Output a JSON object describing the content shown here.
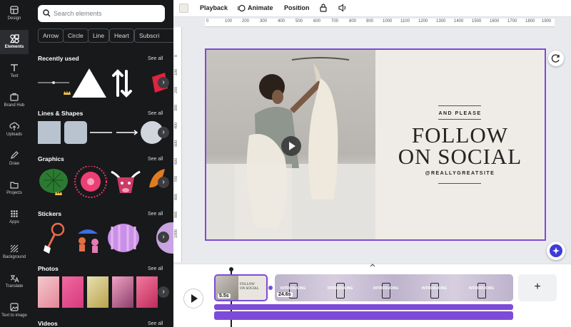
{
  "rail": {
    "items": [
      {
        "label": "Design",
        "icon": "design-icon"
      },
      {
        "label": "Elements",
        "icon": "elements-icon"
      },
      {
        "label": "Text",
        "icon": "text-icon"
      },
      {
        "label": "Brand Hub",
        "icon": "brand-hub-icon"
      },
      {
        "label": "Uploads",
        "icon": "uploads-icon"
      },
      {
        "label": "Draw",
        "icon": "draw-icon"
      },
      {
        "label": "Projects",
        "icon": "projects-icon"
      },
      {
        "label": "Apps",
        "icon": "apps-icon"
      },
      {
        "label": "Background",
        "icon": "background-icon"
      },
      {
        "label": "Translate",
        "icon": "translate-icon"
      },
      {
        "label": "Text to image",
        "icon": "text-to-image-icon"
      }
    ]
  },
  "panel": {
    "search_placeholder": "Search elements",
    "chips": [
      "Arrow",
      "Circle",
      "Line",
      "Heart",
      "Subscri"
    ],
    "sections": {
      "recent": {
        "title": "Recently used",
        "see_all": "See all"
      },
      "lines": {
        "title": "Lines & Shapes",
        "see_all": "See all"
      },
      "graphics": {
        "title": "Graphics",
        "see_all": "See all"
      },
      "stickers": {
        "title": "Stickers",
        "see_all": "See all"
      },
      "photos": {
        "title": "Photos",
        "see_all": "See all"
      },
      "videos": {
        "title": "Videos",
        "see_all": "See all"
      }
    }
  },
  "toolbar": {
    "playback": "Playback",
    "animate": "Animate",
    "position": "Position"
  },
  "ruler": {
    "h": [
      "0",
      "100",
      "200",
      "300",
      "400",
      "500",
      "600",
      "700",
      "800",
      "900",
      "1000",
      "1100",
      "1200",
      "1300",
      "1400",
      "1500",
      "1600",
      "1700",
      "1800",
      "1900"
    ],
    "v": [
      "0",
      "100",
      "200",
      "300",
      "400",
      "500",
      "600",
      "700",
      "800",
      "900",
      "1000"
    ]
  },
  "canvas": {
    "and_please": "AND PLEASE",
    "follow": "FOLLOW",
    "on_social": "ON SOCIAL",
    "handle": "@REALLYGREATSITE"
  },
  "timeline": {
    "clip1_duration": "5.5s",
    "clip2_duration": "24.6s",
    "clip2_frame_text": "INTRODUCING",
    "add_label": "+"
  },
  "colors": {
    "accent": "#7d4bd8",
    "dark": "#18191b"
  }
}
